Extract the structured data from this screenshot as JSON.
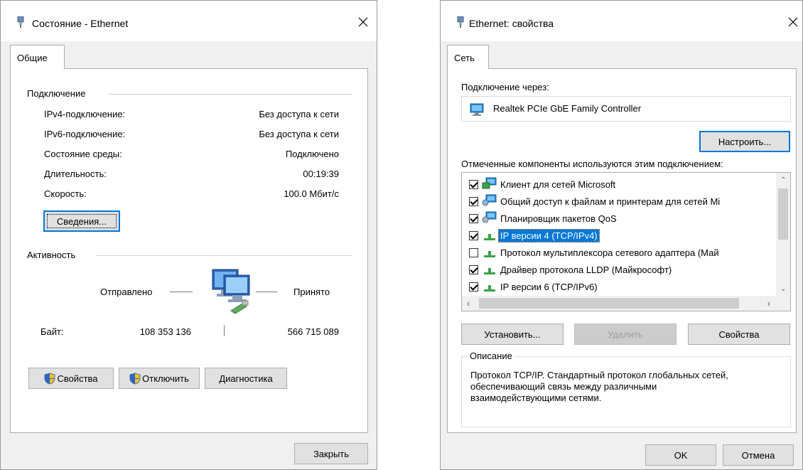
{
  "status_window": {
    "title": "Состояние - Ethernet",
    "tab": "Общие",
    "connection_section": "Подключение",
    "rows": [
      {
        "label": "IPv4-подключение:",
        "value": "Без доступа к сети"
      },
      {
        "label": "IPv6-подключение:",
        "value": "Без доступа к сети"
      },
      {
        "label": "Состояние среды:",
        "value": "Подключено"
      },
      {
        "label": "Длительность:",
        "value": "00:19:39"
      },
      {
        "label": "Скорость:",
        "value": "100.0 Мбит/с"
      }
    ],
    "details_button": "Сведения...",
    "activity_section": "Активность",
    "sent_label": "Отправлено",
    "received_label": "Принято",
    "bytes_label": "Байт:",
    "bytes_sent": "108 353 136",
    "bytes_received": "566 715 089",
    "properties_button": "Свойства",
    "disable_button": "Отключить",
    "diagnostics_button": "Диагностика",
    "close_button": "Закрыть"
  },
  "properties_window": {
    "title": "Ethernet: свойства",
    "tab": "Сеть",
    "connect_using_label": "Подключение через:",
    "adapter_name": "Realtek PCIe GbE Family Controller",
    "configure_button": "Настроить...",
    "components_label": "Отмеченные компоненты используются этим подключением:",
    "components": [
      {
        "label": "Клиент для сетей Microsoft",
        "checked": true,
        "icon": "network-client-icon",
        "selected": false
      },
      {
        "label": "Общий доступ к файлам и принтерам для сетей Mi",
        "checked": true,
        "icon": "file-sharing-icon",
        "selected": false
      },
      {
        "label": "Планировщик пакетов QoS",
        "checked": true,
        "icon": "qos-service-icon",
        "selected": false
      },
      {
        "label": "IP версии 4 (TCP/IPv4)",
        "checked": true,
        "icon": "protocol-icon",
        "selected": true
      },
      {
        "label": "Протокол мультиплексора сетевого адаптера (Май",
        "checked": false,
        "icon": "protocol-icon",
        "selected": false
      },
      {
        "label": "Драйвер протокола LLDP (Майкрософт)",
        "checked": true,
        "icon": "protocol-icon",
        "selected": false
      },
      {
        "label": "IP версии 6 (TCP/IPv6)",
        "checked": true,
        "icon": "protocol-icon",
        "selected": false
      }
    ],
    "install_button": "Установить...",
    "uninstall_button": "Удалить",
    "properties_button": "Свойства",
    "description_legend": "Описание",
    "description_text": "Протокол TCP/IP. Стандартный протокол глобальных сетей, обеспечивающий связь между различными взаимодействующими сетями.",
    "ok_button": "OK",
    "cancel_button": "Отмена"
  },
  "colors": {
    "selection": "#0078d7",
    "window_bg": "#f0f0f0",
    "button_bg": "#e1e1e1"
  }
}
